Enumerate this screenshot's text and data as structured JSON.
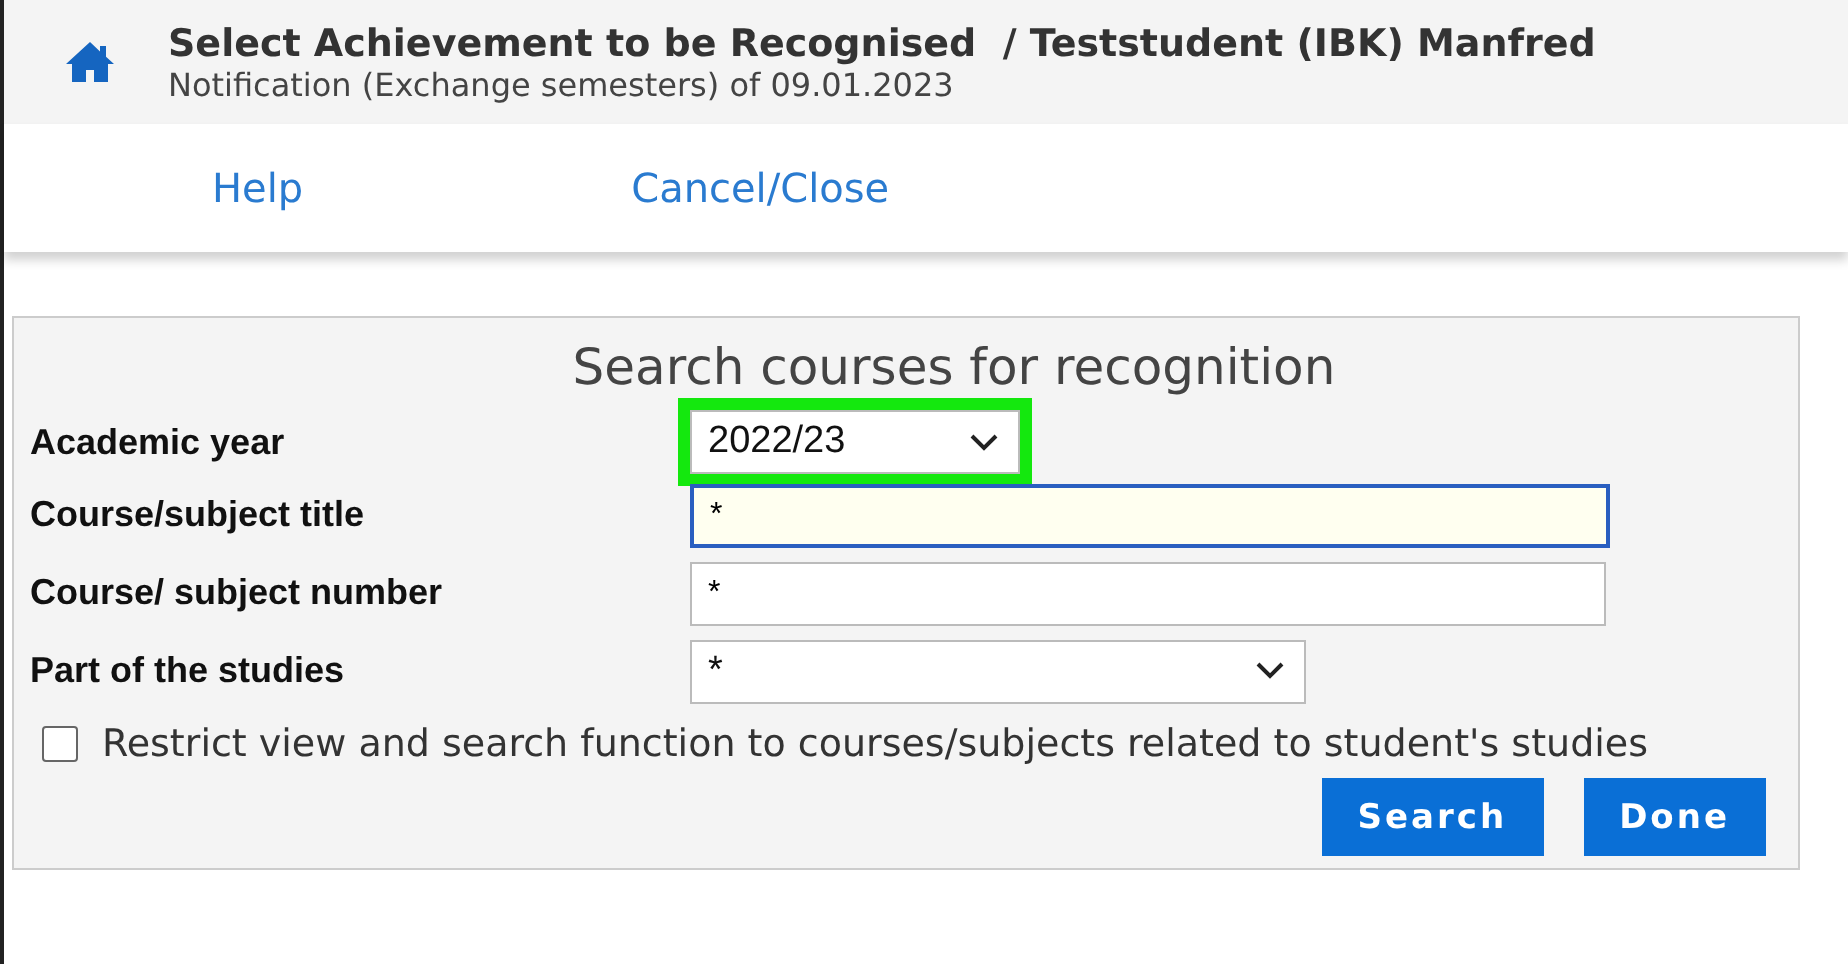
{
  "header": {
    "title": "Select Achievement to be Recognised  / Teststudent (IBK) Manfred",
    "subtitle": "Notification (Exchange semesters) of 09.01.2023"
  },
  "nav_links": [
    "Help",
    "Cancel/Close"
  ],
  "search_panel": {
    "title": "Search courses for recognition",
    "fields": [
      {
        "label": "Academic year",
        "kind": "select",
        "value": "2022/23",
        "focused": false,
        "highlighted": true
      },
      {
        "label": "Course/subject title",
        "kind": "text",
        "value": "*",
        "focused": true,
        "highlighted": false
      },
      {
        "label": "Course/ subject number",
        "kind": "text",
        "value": "*",
        "focused": false,
        "highlighted": false
      },
      {
        "label": "Part of the studies",
        "kind": "select",
        "value": "*",
        "focused": false,
        "highlighted": false
      }
    ],
    "restrict_option": {
      "label": "Restrict view and search function to courses/subjects related to student's studies",
      "checked": false
    },
    "buttons": [
      "Search",
      "Done"
    ]
  }
}
